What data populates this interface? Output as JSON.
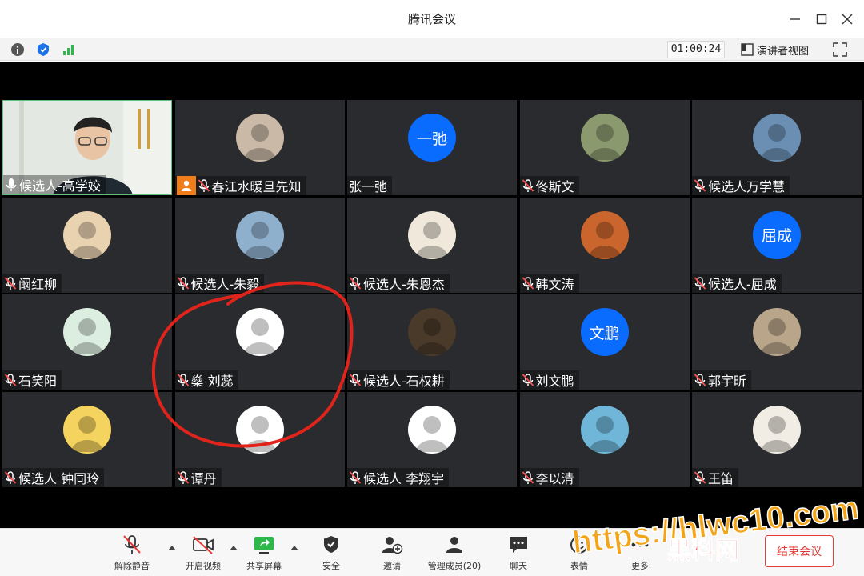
{
  "window": {
    "title": "腾讯会议"
  },
  "statusbar": {
    "timer": "01:00:24",
    "view_label": "演讲者视图"
  },
  "participants": [
    {
      "name": "候选人-高学姣",
      "avatar": "video",
      "mic": "on"
    },
    {
      "name": "春江水暖旦先知",
      "avatar": "image",
      "mic": "muted",
      "host": true
    },
    {
      "name": "张一弛",
      "avatar": "text",
      "avatar_text": "一弛",
      "mic": "none"
    },
    {
      "name": "佟斯文",
      "avatar": "image",
      "mic": "muted"
    },
    {
      "name": "候选人万学慧",
      "avatar": "image",
      "mic": "muted"
    },
    {
      "name": "阚红柳",
      "avatar": "image",
      "mic": "muted"
    },
    {
      "name": "候选人-朱毅",
      "avatar": "image",
      "mic": "muted"
    },
    {
      "name": "候选人-朱恩杰",
      "avatar": "image",
      "mic": "muted"
    },
    {
      "name": "韩文涛",
      "avatar": "image",
      "mic": "muted"
    },
    {
      "name": "候选人-屈成",
      "avatar": "text",
      "avatar_text": "屈成",
      "mic": "muted"
    },
    {
      "name": "石笑阳",
      "avatar": "image",
      "mic": "muted"
    },
    {
      "name": "燊 刘蕊",
      "avatar": "image",
      "mic": "muted"
    },
    {
      "name": "候选人-石权耕",
      "avatar": "image",
      "mic": "muted"
    },
    {
      "name": "刘文鹏",
      "avatar": "text",
      "avatar_text": "文鹏",
      "mic": "muted"
    },
    {
      "name": "郭宇昕",
      "avatar": "image",
      "mic": "muted"
    },
    {
      "name": "候选人 钟同玲",
      "avatar": "image",
      "mic": "muted"
    },
    {
      "name": "谭丹",
      "avatar": "image",
      "mic": "muted"
    },
    {
      "name": "候选人 李翔宇",
      "avatar": "image",
      "mic": "muted"
    },
    {
      "name": "李以清",
      "avatar": "image",
      "mic": "muted"
    },
    {
      "name": "王笛",
      "avatar": "image",
      "mic": "muted"
    }
  ],
  "toolbar": {
    "unmute": "解除静音",
    "start_video": "开启视频",
    "share_screen": "共享屏幕",
    "security": "安全",
    "invite": "邀请",
    "manage_members": "管理成员(20)",
    "chat": "聊天",
    "reactions": "表情",
    "more": "更多",
    "end_meeting": "结束会议"
  },
  "watermark": {
    "line1": "https://hlwc10.com",
    "line2": "黑料网"
  },
  "colors": {
    "accent_blue": "#0a6cff",
    "end_red": "#e53935",
    "host_orange": "#f07d1a",
    "tile_bg": "#2a2b2e",
    "annotation_red": "#e0241b"
  }
}
